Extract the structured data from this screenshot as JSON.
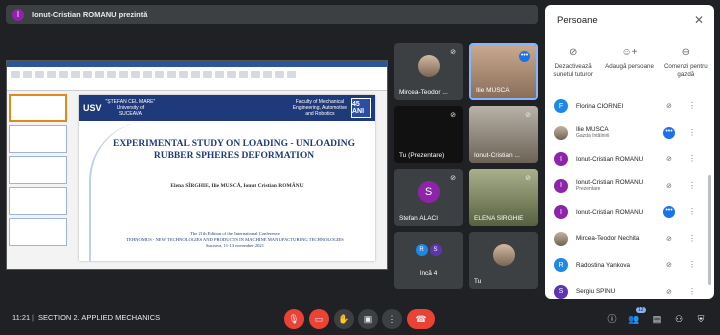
{
  "banner": {
    "avatar_letter": "I",
    "text": "Ionut-Cristian ROMANU prezintă"
  },
  "slide": {
    "university_line1": "\"ȘTEFAN CEL MARE\"",
    "university_line2": "University of",
    "university_line3": "SUCEAVA",
    "university_logo": "USV",
    "faculty_line1": "Faculty of Mechanical",
    "faculty_line2": "Engineering, Automotive",
    "faculty_line3": "and Robotics",
    "badge": "45 ANI",
    "title_line1": "EXPERIMENTAL STUDY ON LOADING - UNLOADING",
    "title_line2": "RUBBER SPHERES DEFORMATION",
    "authors": "Elena SÎRGHIE, Ilie MUSCĂ, Ionut Cristian ROMÂNU",
    "conf_line1": "The 21th Edition of the International Conference",
    "conf_line2": "TEHNOMUS - NEW TECHNOLOGIES AND PRODUCTS IN MACHINE MANUFACTURING TECHNOLOGIES",
    "conf_line3": "Suceava, 11-13 november 2021"
  },
  "tiles": [
    {
      "name": "Mircea-Teodor ..."
    },
    {
      "name": "Ilie MUSCA"
    },
    {
      "name": "Tu (Prezentare)"
    },
    {
      "name": "Ionut-Cristian ..."
    },
    {
      "name": "Stefan ALACI",
      "letter": "S"
    },
    {
      "name": "ELENA SÎRGHIE"
    },
    {
      "name": "Încă 4",
      "letter_a": "R",
      "letter_b": "S"
    },
    {
      "name": "Tu"
    }
  ],
  "panel": {
    "title": "Persoane",
    "actions": [
      {
        "label": "Dezactivează sunetul tuturor",
        "icon": "mic-off-icon"
      },
      {
        "label": "Adaugă persoane",
        "icon": "person-add-icon"
      },
      {
        "label": "Comenzi pentru gazdă",
        "icon": "toggle-icon"
      }
    ],
    "people": [
      {
        "letter": "F",
        "color": "#1e88e5",
        "name": "Florina CIORNEI",
        "sub": ""
      },
      {
        "letter": "",
        "color": "",
        "name": "Ilie MUSCA",
        "sub": "Gazda întâlnirii"
      },
      {
        "letter": "I",
        "color": "#8e24aa",
        "name": "Ionut-Cristian ROMANU",
        "sub": ""
      },
      {
        "letter": "I",
        "color": "#8e24aa",
        "name": "Ionut-Cristian ROMANU",
        "sub": "Prezentare"
      },
      {
        "letter": "I",
        "color": "#8e24aa",
        "name": "Ionut-Cristian ROMANU",
        "sub": ""
      },
      {
        "letter": "",
        "color": "",
        "name": "Mircea-Teodor Nechita",
        "sub": ""
      },
      {
        "letter": "R",
        "color": "#1e88e5",
        "name": "Radostina Yankova",
        "sub": ""
      },
      {
        "letter": "S",
        "color": "#5e35b1",
        "name": "Sergiu SPÎNU",
        "sub": ""
      }
    ]
  },
  "bottom": {
    "time": "11:21",
    "separator": "|",
    "meeting": "SECTION 2. APPLIED MECHANICS",
    "participant_count": "12"
  }
}
